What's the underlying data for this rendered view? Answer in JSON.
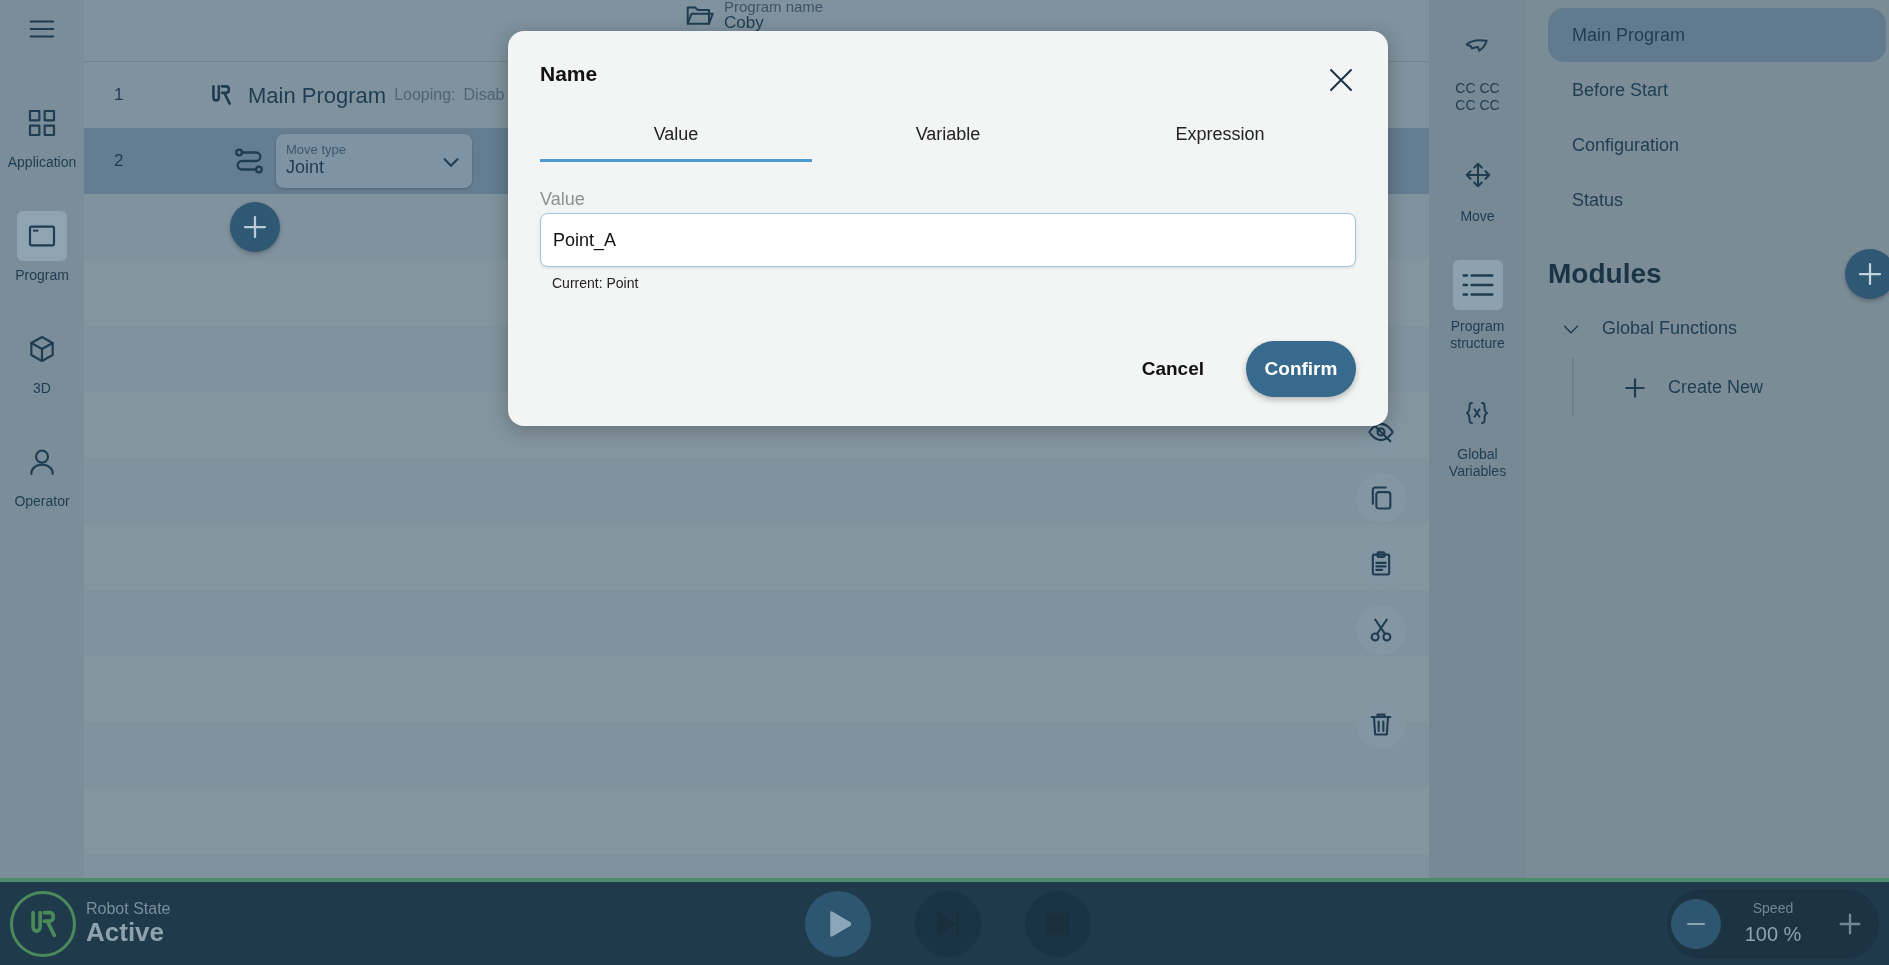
{
  "nav_sidebar": {
    "items": [
      {
        "label": "Application",
        "selected": false
      },
      {
        "label": "Program",
        "selected": true
      },
      {
        "label": "3D",
        "selected": false
      },
      {
        "label": "Operator",
        "selected": false
      }
    ]
  },
  "program_header": {
    "label": "Program name",
    "value": "Coby"
  },
  "program_rows": [
    {
      "number": "1",
      "kind": "main",
      "title": "Main Program",
      "info_label": "Looping:",
      "info_value": "Disab",
      "selected": false
    },
    {
      "number": "2",
      "kind": "move",
      "field_label": "Move type",
      "field_value": "Joint",
      "selected": true
    }
  ],
  "tools": [
    {
      "label": "CC CC\nCC CC",
      "selected": false
    },
    {
      "label": "Move",
      "selected": false
    },
    {
      "label": "Program\nstructure",
      "selected": true
    },
    {
      "label": "Global\nVariables",
      "selected": false
    }
  ],
  "structure": {
    "items": [
      {
        "label": "Main Program",
        "selected": true
      },
      {
        "label": "Before Start",
        "selected": false
      },
      {
        "label": "Configuration",
        "selected": false
      },
      {
        "label": "Status",
        "selected": false
      }
    ],
    "modules_title": "Modules",
    "modules": [
      {
        "label": "Global Functions",
        "expanded": true,
        "children": [
          {
            "label": "Create New"
          }
        ]
      }
    ]
  },
  "dialog": {
    "title": "Name",
    "tabs": [
      {
        "label": "Value",
        "selected": true
      },
      {
        "label": "Variable",
        "selected": false
      },
      {
        "label": "Expression",
        "selected": false
      }
    ],
    "field_label": "Value",
    "field_value": "Point_A",
    "helper": "Current: Point",
    "buttons": [
      {
        "label": "Cancel",
        "kind": "text"
      },
      {
        "label": "Confirm",
        "kind": "primary"
      }
    ]
  },
  "status_bar": {
    "state_label": "Robot State",
    "state_value": "Active",
    "controls": [
      {
        "kind": "play",
        "disabled": false
      },
      {
        "kind": "step",
        "disabled": true
      },
      {
        "kind": "stop",
        "disabled": true
      }
    ],
    "speed_label": "Speed",
    "speed_value": "100 %"
  }
}
